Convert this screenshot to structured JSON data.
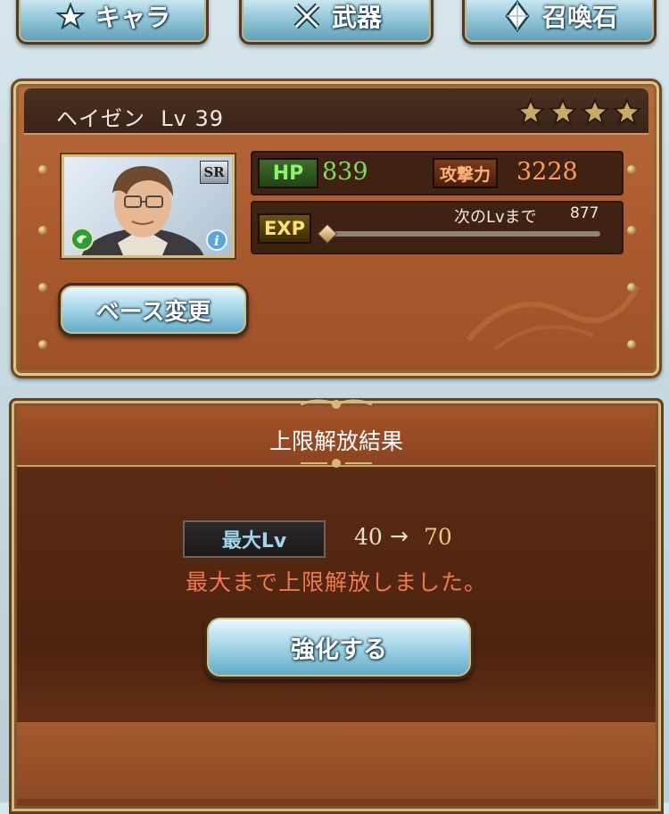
{
  "tabs": [
    {
      "label": "キャラ",
      "icon": "character-emblem-icon"
    },
    {
      "label": "武器",
      "icon": "crossed-swords-icon"
    },
    {
      "label": "召喚石",
      "icon": "summon-crystal-icon"
    }
  ],
  "character": {
    "name": "ヘイゼン",
    "level_text": "Lv 39",
    "rarity": "SR",
    "stars_filled": 4,
    "hp_label": "HP",
    "hp": "839",
    "atk_label": "攻撃力",
    "atk": "3228",
    "exp_label": "EXP",
    "next_lv_label": "次のLvまで",
    "next_lv_exp": "877",
    "exp_progress": 0.0,
    "base_change_label": "ベース変更"
  },
  "result": {
    "title": "上限解放結果",
    "max_lv_label": "最大Lv",
    "from": "40",
    "arrow": "→",
    "to": "70",
    "message": "最大まで上限解放しました。",
    "enhance_label": "強化する"
  },
  "colors": {
    "panel_brown": "#a9582d",
    "button_blue": "#a9d8ea",
    "hp_green": "#7fd95e",
    "atk_orange": "#ff9a5c",
    "message_red": "#ef7a4f",
    "level_gold": "#e6c67a"
  }
}
